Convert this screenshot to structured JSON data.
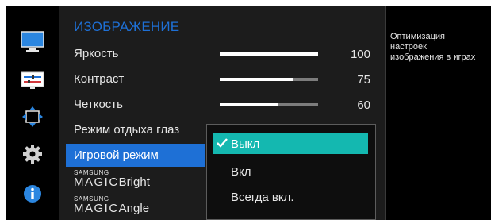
{
  "menu": {
    "title": "ИЗОБРАЖЕНИЕ",
    "items": [
      {
        "label": "Яркость",
        "value": "100",
        "level": 1.0
      },
      {
        "label": "Контраст",
        "value": "75",
        "level": 0.75
      },
      {
        "label": "Четкость",
        "value": "60",
        "level": 0.6
      },
      {
        "label": "Режим отдыха глаз"
      },
      {
        "label": "Игровой режим",
        "selected": true
      },
      {
        "brand_top": "SAMSUNG",
        "brand_main": "MAGIC",
        "label": "Bright"
      },
      {
        "brand_top": "SAMSUNG",
        "brand_main": "MAGIC",
        "label": "Angle"
      }
    ]
  },
  "dropdown": {
    "options": [
      {
        "label": "Выкл",
        "selected": true
      },
      {
        "label": "Вкл"
      },
      {
        "label": "Всегда вкл."
      }
    ]
  },
  "help": {
    "text": "Оптимизация\nнастроек\nизображения в играх"
  },
  "nav_icons": [
    "monitor-icon",
    "sliders-icon",
    "resize-arrows-icon",
    "gear-icon",
    "info-icon"
  ],
  "colors": {
    "accent": "#1e70d6",
    "dropdown_selected": "#14b8b0",
    "title": "#1e70d6"
  }
}
